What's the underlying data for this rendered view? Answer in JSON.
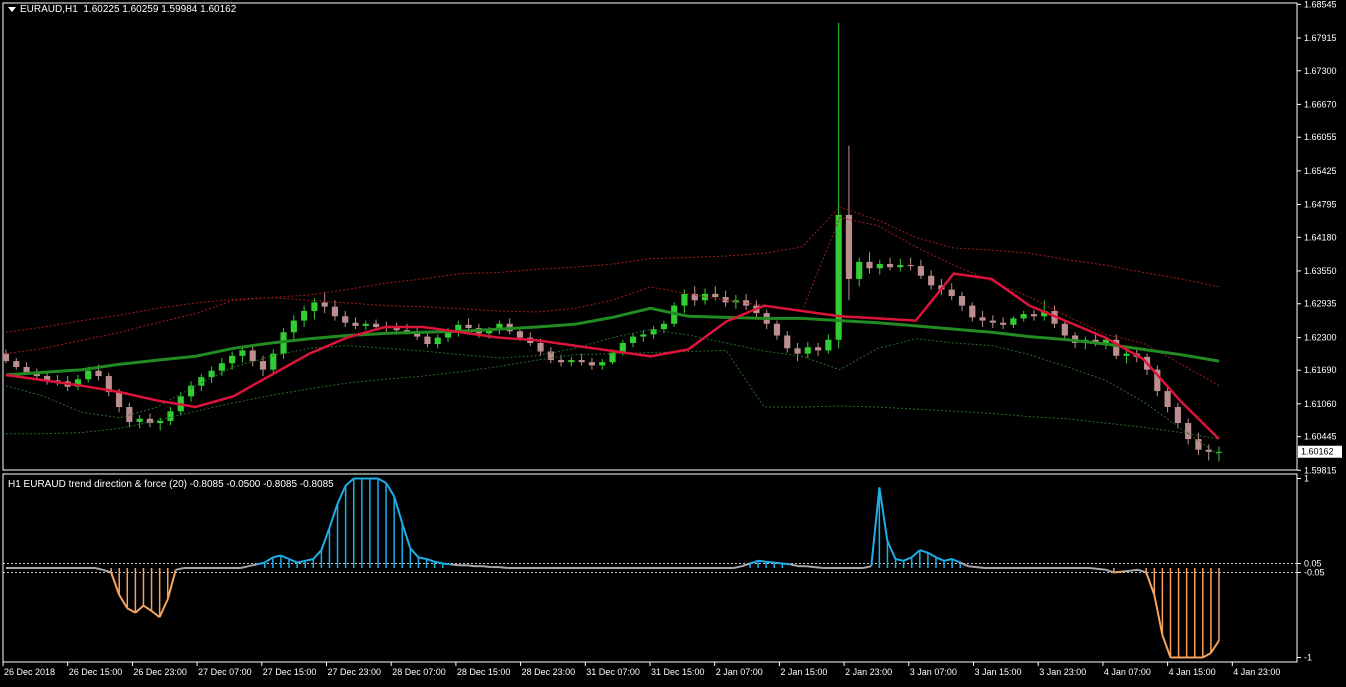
{
  "header": {
    "symbol": "EURAUD,H1",
    "ohlc": "1.60225 1.60259 1.59984 1.60162"
  },
  "indicator": {
    "title": "H1 EURAUD trend direction & force (20) -0.8085 -0.0500 -0.8085 -0.8085"
  },
  "colors": {
    "background": "#000000",
    "frame": "#ffffff",
    "bull_candle": "#32cd32",
    "bear_candle": "#bc8f8f",
    "ma_fast": "#dc143c",
    "ma_slow": "#228b22",
    "band_upper": "#a11c1c",
    "band_lower": "#2a6a2a",
    "hist_up": "#1eaee8",
    "hist_down": "#f4a460",
    "hist_neutral": "#a9a9a9"
  },
  "chart_data": [
    {
      "type": "candlestick",
      "title": "EURAUD,H1",
      "price_ticks": [
        "1.68545",
        "1.67915",
        "1.67300",
        "1.66670",
        "1.66055",
        "1.65425",
        "1.64795",
        "1.64180",
        "1.63550",
        "1.62935",
        "1.62300",
        "1.61690",
        "1.61060",
        "1.60445",
        "1.59815"
      ],
      "current_price": "1.60162",
      "time_labels": [
        "26 Dec 2018",
        "26 Dec 15:00",
        "26 Dec 23:00",
        "27 Dec 07:00",
        "27 Dec 15:00",
        "27 Dec 23:00",
        "28 Dec 07:00",
        "28 Dec 15:00",
        "28 Dec 23:00",
        "31 Dec 07:00",
        "31 Dec 15:00",
        "2 Jan 07:00",
        "2 Jan 15:00",
        "2 Jan 23:00",
        "3 Jan 07:00",
        "3 Jan 15:00",
        "3 Jan 23:00",
        "4 Jan 07:00",
        "4 Jan 15:00",
        "4 Jan 23:00"
      ],
      "ylim": [
        1.5982,
        1.6857
      ],
      "candles": [
        [
          1.62,
          1.6208,
          1.6182,
          1.6186
        ],
        [
          1.6186,
          1.6192,
          1.617,
          1.6175
        ],
        [
          1.6175,
          1.6184,
          1.616,
          1.6165
        ],
        [
          1.6165,
          1.6172,
          1.615,
          1.6158
        ],
        [
          1.6158,
          1.6166,
          1.6142,
          1.615
        ],
        [
          1.615,
          1.616,
          1.614,
          1.6148
        ],
        [
          1.6148,
          1.6158,
          1.613,
          1.6138
        ],
        [
          1.6138,
          1.616,
          1.6132,
          1.6152
        ],
        [
          1.6152,
          1.6176,
          1.6146,
          1.6168
        ],
        [
          1.6168,
          1.618,
          1.615,
          1.6158
        ],
        [
          1.6158,
          1.6164,
          1.612,
          1.6128
        ],
        [
          1.6128,
          1.6134,
          1.609,
          1.61
        ],
        [
          1.61,
          1.6108,
          1.6062,
          1.6072
        ],
        [
          1.6072,
          1.6085,
          1.606,
          1.6078
        ],
        [
          1.6078,
          1.6088,
          1.6062,
          1.607
        ],
        [
          1.607,
          1.608,
          1.6056,
          1.6074
        ],
        [
          1.6074,
          1.61,
          1.6066,
          1.6092
        ],
        [
          1.6092,
          1.6128,
          1.6084,
          1.612
        ],
        [
          1.612,
          1.6148,
          1.611,
          1.614
        ],
        [
          1.614,
          1.6162,
          1.613,
          1.6156
        ],
        [
          1.6156,
          1.6176,
          1.6145,
          1.6168
        ],
        [
          1.6168,
          1.6192,
          1.6158,
          1.6182
        ],
        [
          1.6182,
          1.6204,
          1.617,
          1.6196
        ],
        [
          1.6196,
          1.6214,
          1.6184,
          1.6206
        ],
        [
          1.6206,
          1.6218,
          1.6176,
          1.6186
        ],
        [
          1.6186,
          1.6196,
          1.6158,
          1.617
        ],
        [
          1.617,
          1.6208,
          1.616,
          1.62
        ],
        [
          1.62,
          1.6248,
          1.619,
          1.624
        ],
        [
          1.624,
          1.6272,
          1.6228,
          1.6262
        ],
        [
          1.6262,
          1.629,
          1.625,
          1.628
        ],
        [
          1.628,
          1.6304,
          1.6264,
          1.6296
        ],
        [
          1.6296,
          1.6316,
          1.6276,
          1.6288
        ],
        [
          1.6288,
          1.63,
          1.6262,
          1.627
        ],
        [
          1.627,
          1.628,
          1.625,
          1.6258
        ],
        [
          1.6258,
          1.6268,
          1.6246,
          1.6252
        ],
        [
          1.6252,
          1.6262,
          1.6244,
          1.6256
        ],
        [
          1.6256,
          1.6264,
          1.6246,
          1.625
        ],
        [
          1.625,
          1.626,
          1.624,
          1.6248
        ],
        [
          1.6248,
          1.6258,
          1.6238,
          1.6244
        ],
        [
          1.6244,
          1.6256,
          1.6236,
          1.624
        ],
        [
          1.624,
          1.625,
          1.6226,
          1.6232
        ],
        [
          1.6232,
          1.624,
          1.6212,
          1.6218
        ],
        [
          1.6218,
          1.6236,
          1.621,
          1.623
        ],
        [
          1.623,
          1.6248,
          1.6222,
          1.6242
        ],
        [
          1.6242,
          1.6262,
          1.6232,
          1.6254
        ],
        [
          1.6254,
          1.6266,
          1.624,
          1.6248
        ],
        [
          1.6248,
          1.6256,
          1.623,
          1.6238
        ],
        [
          1.6238,
          1.625,
          1.6228,
          1.6244
        ],
        [
          1.6244,
          1.6262,
          1.6236,
          1.6256
        ],
        [
          1.6256,
          1.6266,
          1.6236,
          1.6242
        ],
        [
          1.6242,
          1.625,
          1.6224,
          1.623
        ],
        [
          1.623,
          1.624,
          1.6214,
          1.622
        ],
        [
          1.622,
          1.6228,
          1.6196,
          1.6204
        ],
        [
          1.6204,
          1.6212,
          1.6182,
          1.6188
        ],
        [
          1.6188,
          1.6198,
          1.6176,
          1.6184
        ],
        [
          1.6184,
          1.6194,
          1.6176,
          1.6188
        ],
        [
          1.6188,
          1.62,
          1.6178,
          1.6184
        ],
        [
          1.6184,
          1.6192,
          1.617,
          1.6178
        ],
        [
          1.6178,
          1.619,
          1.617,
          1.6184
        ],
        [
          1.6184,
          1.6208,
          1.618,
          1.6202
        ],
        [
          1.6202,
          1.6226,
          1.6196,
          1.622
        ],
        [
          1.622,
          1.6238,
          1.6212,
          1.6232
        ],
        [
          1.6232,
          1.6244,
          1.6222,
          1.6236
        ],
        [
          1.6236,
          1.6252,
          1.6228,
          1.6246
        ],
        [
          1.6246,
          1.6262,
          1.6238,
          1.6256
        ],
        [
          1.6256,
          1.6296,
          1.625,
          1.629
        ],
        [
          1.629,
          1.632,
          1.6276,
          1.6312
        ],
        [
          1.6312,
          1.6326,
          1.629,
          1.63
        ],
        [
          1.63,
          1.6322,
          1.6292,
          1.6312
        ],
        [
          1.6312,
          1.6326,
          1.63,
          1.6306
        ],
        [
          1.6306,
          1.6318,
          1.6288,
          1.6296
        ],
        [
          1.6296,
          1.631,
          1.6284,
          1.63
        ],
        [
          1.63,
          1.6312,
          1.6282,
          1.629
        ],
        [
          1.629,
          1.63,
          1.6268,
          1.6276
        ],
        [
          1.6276,
          1.6282,
          1.6246,
          1.6256
        ],
        [
          1.6256,
          1.6262,
          1.6226,
          1.6234
        ],
        [
          1.6234,
          1.6242,
          1.6202,
          1.621
        ],
        [
          1.621,
          1.622,
          1.6186,
          1.62
        ],
        [
          1.62,
          1.6222,
          1.6192,
          1.6212
        ],
        [
          1.6212,
          1.622,
          1.6196,
          1.6206
        ],
        [
          1.6206,
          1.6236,
          1.62,
          1.6226
        ],
        [
          1.6226,
          1.682,
          1.621,
          1.646
        ],
        [
          1.646,
          1.659,
          1.63,
          1.634
        ],
        [
          1.634,
          1.638,
          1.6326,
          1.6372
        ],
        [
          1.6372,
          1.639,
          1.635,
          1.636
        ],
        [
          1.636,
          1.6376,
          1.6348,
          1.6368
        ],
        [
          1.6368,
          1.638,
          1.6356,
          1.6362
        ],
        [
          1.6362,
          1.6378,
          1.6354,
          1.6366
        ],
        [
          1.6366,
          1.638,
          1.6356,
          1.6364
        ],
        [
          1.6364,
          1.6376,
          1.634,
          1.6346
        ],
        [
          1.6346,
          1.6356,
          1.632,
          1.6328
        ],
        [
          1.6328,
          1.634,
          1.631,
          1.632
        ],
        [
          1.632,
          1.6332,
          1.63,
          1.6308
        ],
        [
          1.6308,
          1.6316,
          1.628,
          1.629
        ],
        [
          1.629,
          1.6296,
          1.626,
          1.6268
        ],
        [
          1.6268,
          1.628,
          1.625,
          1.6262
        ],
        [
          1.6262,
          1.6272,
          1.6248,
          1.6258
        ],
        [
          1.6258,
          1.6268,
          1.6246,
          1.6254
        ],
        [
          1.6254,
          1.627,
          1.6248,
          1.6266
        ],
        [
          1.6266,
          1.628,
          1.626,
          1.6274
        ],
        [
          1.6274,
          1.6282,
          1.6262,
          1.627
        ],
        [
          1.627,
          1.63,
          1.6262,
          1.628
        ],
        [
          1.628,
          1.629,
          1.6248,
          1.6256
        ],
        [
          1.6256,
          1.6262,
          1.6226,
          1.6234
        ],
        [
          1.6234,
          1.624,
          1.621,
          1.622
        ],
        [
          1.622,
          1.6232,
          1.6208,
          1.6226
        ],
        [
          1.6226,
          1.6236,
          1.6214,
          1.6218
        ],
        [
          1.6218,
          1.6232,
          1.6208,
          1.6226
        ],
        [
          1.6226,
          1.6236,
          1.619,
          1.6196
        ],
        [
          1.6196,
          1.6206,
          1.6182,
          1.62
        ],
        [
          1.62,
          1.6208,
          1.6184,
          1.6194
        ],
        [
          1.6194,
          1.62,
          1.616,
          1.617
        ],
        [
          1.617,
          1.6178,
          1.612,
          1.613
        ],
        [
          1.613,
          1.614,
          1.609,
          1.61
        ],
        [
          1.61,
          1.6108,
          1.606,
          1.607
        ],
        [
          1.607,
          1.6078,
          1.603,
          1.604
        ],
        [
          1.604,
          1.6052,
          1.601,
          1.602
        ],
        [
          1.602,
          1.603,
          1.6,
          1.6016
        ],
        [
          1.6016,
          1.6026,
          1.5998,
          1.6016
        ]
      ],
      "ma_fast": [
        1.616,
        1.615,
        1.614,
        1.6128,
        1.6112,
        1.61,
        1.612,
        1.616,
        1.62,
        1.623,
        1.625,
        1.625,
        1.624,
        1.623,
        1.6225,
        1.6215,
        1.6205,
        1.6195,
        1.6208,
        1.626,
        1.629,
        1.628,
        1.627,
        1.6266,
        1.6262,
        1.635,
        1.634,
        1.629,
        1.626,
        1.623,
        1.619,
        1.611,
        1.604
      ],
      "ma_slow": [
        1.616,
        1.6165,
        1.617,
        1.618,
        1.6188,
        1.6195,
        1.621,
        1.622,
        1.6228,
        1.6234,
        1.6238,
        1.624,
        1.6242,
        1.6246,
        1.625,
        1.6255,
        1.6268,
        1.6285,
        1.627,
        1.6268,
        1.6266,
        1.6266,
        1.6262,
        1.6258,
        1.6252,
        1.6246,
        1.624,
        1.6232,
        1.6226,
        1.6218,
        1.6208,
        1.6198,
        1.6186
      ],
      "band_upper": [
        1.624,
        1.625,
        1.6262,
        1.6272,
        1.6285,
        1.6295,
        1.6302,
        1.6305,
        1.631,
        1.632,
        1.6332,
        1.634,
        1.635,
        1.6352,
        1.6358,
        1.6362,
        1.6368,
        1.6378,
        1.638,
        1.6383,
        1.6388,
        1.64,
        1.6475,
        1.645,
        1.6418,
        1.6398,
        1.6394,
        1.6388,
        1.6376,
        1.6366,
        1.6352,
        1.634,
        1.6325
      ],
      "band_lower": [
        1.605,
        1.605,
        1.6052,
        1.606,
        1.6075,
        1.6092,
        1.6108,
        1.6122,
        1.6134,
        1.6145,
        1.6152,
        1.6158,
        1.6166,
        1.6176,
        1.6188,
        1.6198,
        1.62,
        1.6202,
        1.6204,
        1.6206,
        1.61,
        1.61,
        1.6102,
        1.61,
        1.6096,
        1.6092,
        1.6088,
        1.6082,
        1.6078,
        1.607,
        1.6062,
        1.6052,
        1.604
      ],
      "bands_outer_upper": [
        1.62,
        1.621,
        1.6225,
        1.624,
        1.6258,
        1.6275,
        1.63,
        1.6305,
        1.63,
        1.6295,
        1.629,
        1.6288,
        1.6284,
        1.628,
        1.6278,
        1.6285,
        1.63,
        1.6325,
        1.6312,
        1.63,
        1.629,
        1.628,
        1.6455,
        1.644,
        1.64,
        1.6366,
        1.6336,
        1.6306,
        1.627,
        1.6236,
        1.622,
        1.618,
        1.614
      ],
      "bands_outer_lower": [
        1.614,
        1.612,
        1.609,
        1.608,
        1.61,
        1.614,
        1.6175,
        1.6195,
        1.621,
        1.6215,
        1.621,
        1.6205,
        1.6198,
        1.6192,
        1.6196,
        1.621,
        1.623,
        1.6245,
        1.6235,
        1.622,
        1.6205,
        1.6195,
        1.617,
        1.621,
        1.6228,
        1.622,
        1.6215,
        1.6198,
        1.6175,
        1.615,
        1.611,
        1.606,
        1.601
      ]
    },
    {
      "type": "bar",
      "title": "H1 EURAUD trend direction & force (20)",
      "ylim": [
        -1.05,
        1.05
      ],
      "y_ticks": [
        "1",
        "0.05",
        "-0.05",
        "-1"
      ],
      "levels": [
        0.05,
        -0.05
      ],
      "values": [
        0,
        0,
        0,
        0,
        0,
        0,
        0,
        0,
        0,
        0,
        0,
        0,
        -0.02,
        -0.05,
        -0.3,
        -0.45,
        -0.5,
        -0.42,
        -0.48,
        -0.55,
        -0.35,
        -0.02,
        0,
        0,
        0,
        0,
        0,
        0,
        0,
        0,
        0.02,
        0.04,
        0.06,
        0.12,
        0.14,
        0.1,
        0.06,
        0.08,
        0.1,
        0.2,
        0.45,
        0.72,
        0.92,
        1.0,
        1.0,
        1.0,
        1.0,
        0.95,
        0.8,
        0.5,
        0.22,
        0.12,
        0.1,
        0.07,
        0.05,
        0.04,
        0.03,
        0.03,
        0.02,
        0.02,
        0.01,
        0.01,
        0,
        0,
        0,
        0,
        0,
        0,
        0,
        0,
        0,
        0,
        0,
        0,
        0,
        0,
        0,
        0,
        0,
        0,
        0,
        0,
        0,
        0,
        0,
        0,
        0,
        0,
        0,
        0,
        0,
        0.02,
        0.05,
        0.08,
        0.07,
        0.06,
        0.05,
        0.04,
        0.02,
        0.02,
        0.01,
        0,
        0,
        0,
        0,
        0,
        0,
        0.02,
        0.9,
        0.3,
        0.1,
        0.08,
        0.12,
        0.2,
        0.17,
        0.12,
        0.08,
        0.1,
        0.06,
        0.02,
        0.01,
        0,
        0,
        0,
        0,
        0,
        0,
        0,
        0,
        0,
        0,
        0,
        0,
        0,
        0,
        -0.01,
        -0.02,
        -0.05,
        -0.04,
        -0.03,
        -0.02,
        -0.05,
        -0.3,
        -0.75,
        -1.0,
        -1.0,
        -1.0,
        -1.0,
        -1.0,
        -0.95,
        -0.81
      ]
    }
  ]
}
